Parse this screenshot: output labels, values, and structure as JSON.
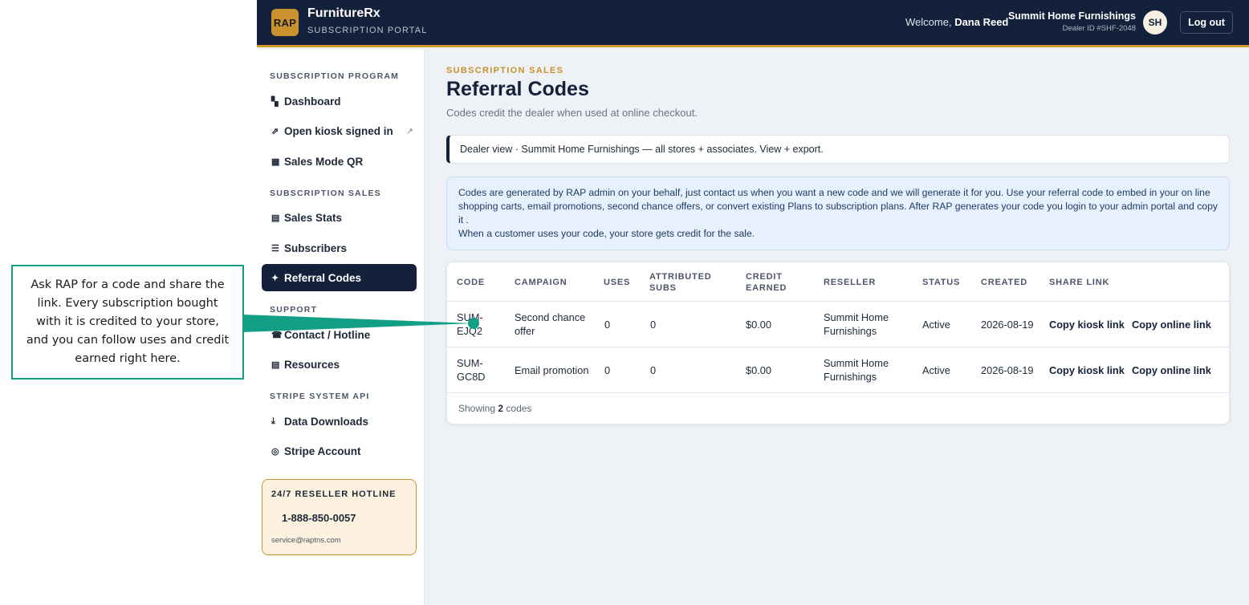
{
  "header": {
    "logo_text": "RAP",
    "brand": "FurnitureRx",
    "brand_sub": "SUBSCRIPTION PORTAL",
    "welcome_prefix": "Welcome,",
    "user_name": "Dana Reed",
    "dealer_name": "Summit Home Furnishings",
    "dealer_id": "Dealer ID #SHF-2048",
    "avatar_initials": "SH",
    "logout_label": "Log out"
  },
  "sidebar": {
    "sections": [
      {
        "title": "SUBSCRIPTION PROGRAM"
      },
      {
        "title": "SUBSCRIPTION SALES"
      },
      {
        "title": "SUPPORT"
      },
      {
        "title": "STRIPE SYSTEM API"
      }
    ],
    "items": [
      {
        "icon": "▚",
        "label": "Dashboard"
      },
      {
        "icon": "⇗",
        "label": "Open kiosk signed in",
        "ext": "↗"
      },
      {
        "icon": "▦",
        "label": "Sales Mode QR"
      },
      {
        "icon": "▤",
        "label": "Sales Stats"
      },
      {
        "icon": "☰",
        "label": "Subscribers"
      },
      {
        "icon": "✦",
        "label": "Referral Codes"
      },
      {
        "icon": "☎",
        "label": "Contact / Hotline"
      },
      {
        "icon": "▤",
        "label": "Resources"
      },
      {
        "icon": "⤓",
        "label": "Data Downloads"
      },
      {
        "icon": "◎",
        "label": "Stripe Account"
      }
    ],
    "hotline": {
      "title": "24/7 RESELLER HOTLINE",
      "phone": "1-888-850-0057",
      "email": "service@raptns.com"
    }
  },
  "main": {
    "eyebrow": "SUBSCRIPTION SALES",
    "title": "Referral Codes",
    "subtitle": "Codes credit the dealer when used at online checkout.",
    "dealer_note": "Dealer view · Summit Home Furnishings — all stores + associates. View + export.",
    "info_line1": "Codes are generated by RAP admin on your behalf, just contact us when you want a new code and we will generate it for you. Use your referral code to embed in your on line shopping carts, email promotions, second chance offers, or convert existing Plans to subscription plans. After RAP generates your code you login to your admin portal and copy it .",
    "info_line2": "When a customer uses your code, your store gets credit for the sale.",
    "table": {
      "columns": [
        "CODE",
        "CAMPAIGN",
        "USES",
        "ATTRIBUTED SUBS",
        "CREDIT EARNED",
        "RESELLER",
        "STATUS",
        "CREATED",
        "SHARE LINK"
      ],
      "rows": [
        {
          "code": "SUM-EJQ2",
          "campaign": "Second chance offer",
          "uses": "0",
          "subs": "0",
          "credit": "$0.00",
          "reseller": "Summit Home Furnishings",
          "status": "Active",
          "created": "2026-08-19",
          "kiosk_link": "Copy kiosk link",
          "online_link": "Copy online link"
        },
        {
          "code": "SUM-GC8D",
          "campaign": "Email promotion",
          "uses": "0",
          "subs": "0",
          "credit": "$0.00",
          "reseller": "Summit Home Furnishings",
          "status": "Active",
          "created": "2026-08-19",
          "kiosk_link": "Copy kiosk link",
          "online_link": "Copy online link"
        }
      ],
      "footer_prefix": "Showing",
      "footer_count": "2",
      "footer_suffix": "codes"
    }
  },
  "callout": {
    "text": "Ask RAP for a code and share the link. Every subscription bought with it is credited to your store, and you can follow uses and credit earned right here.",
    "color": "#11a086"
  }
}
